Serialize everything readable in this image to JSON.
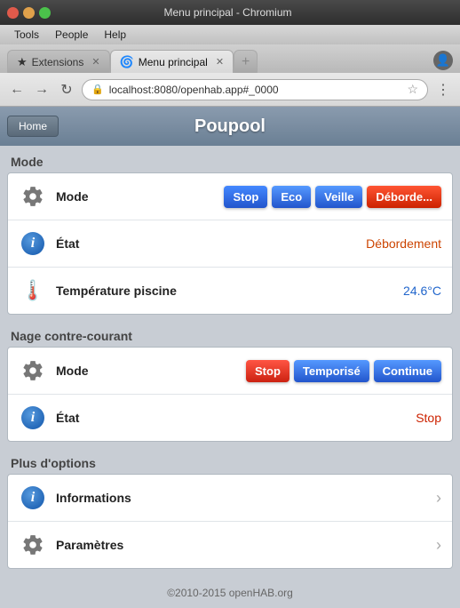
{
  "window": {
    "title": "Menu principal - Chromium",
    "tabs": [
      {
        "label": "Extensions",
        "icon": "★",
        "active": false
      },
      {
        "label": "Menu principal",
        "icon": "🌀",
        "active": true
      }
    ]
  },
  "menubar": {
    "items": [
      "Tools",
      "People",
      "Help"
    ]
  },
  "addressbar": {
    "url": "localhost:8080/openhab.app#_0000",
    "back_disabled": false,
    "forward_disabled": false
  },
  "header": {
    "home_label": "Home",
    "title": "Poupool"
  },
  "sections": [
    {
      "label": "Mode",
      "cards": [
        {
          "rows": [
            {
              "type": "mode_buttons",
              "icon": "gear",
              "label": "Mode",
              "buttons": [
                "Stop",
                "Eco",
                "Veille",
                "Déborde..."
              ]
            },
            {
              "type": "value",
              "icon": "info",
              "label": "État",
              "value": "Débordement",
              "value_color": "orange"
            },
            {
              "type": "value",
              "icon": "thermo",
              "label": "Température piscine",
              "value": "24.6°C",
              "value_color": "blue"
            }
          ]
        }
      ]
    },
    {
      "label": "Nage contre-courant",
      "cards": [
        {
          "rows": [
            {
              "type": "mode_buttons_ncc",
              "icon": "gear",
              "label": "Mode",
              "buttons": [
                "Stop",
                "Temporisé",
                "Continue"
              ]
            },
            {
              "type": "value",
              "icon": "info",
              "label": "État",
              "value": "Stop",
              "value_color": "stop-red"
            }
          ]
        }
      ]
    },
    {
      "label": "Plus d'options",
      "cards": [
        {
          "rows": [
            {
              "type": "link",
              "icon": "info",
              "label": "Informations"
            },
            {
              "type": "link",
              "icon": "gear",
              "label": "Paramètres"
            }
          ]
        }
      ]
    }
  ],
  "footer": {
    "text": "©2010-2015 openHAB.org"
  }
}
